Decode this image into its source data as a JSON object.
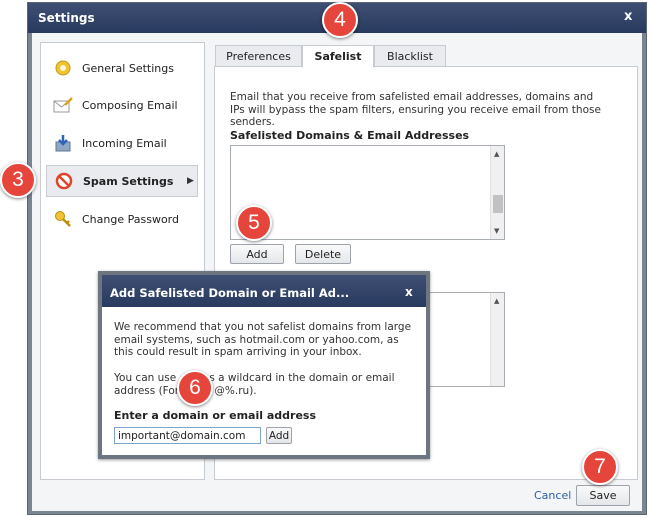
{
  "window": {
    "title": "Settings",
    "close_glyph": "x"
  },
  "sidebar": {
    "items": [
      {
        "label": "General Settings",
        "icon": "gear-icon"
      },
      {
        "label": "Composing Email",
        "icon": "compose-icon"
      },
      {
        "label": "Incoming Email",
        "icon": "inbox-arrow-icon"
      },
      {
        "label": "Spam Settings",
        "icon": "no-entry-icon",
        "selected": true
      },
      {
        "label": "Change Password",
        "icon": "key-icon"
      }
    ],
    "active_arrow": "▶"
  },
  "tabs": [
    {
      "label": "Preferences"
    },
    {
      "label": "Safelist",
      "active": true
    },
    {
      "label": "Blacklist"
    }
  ],
  "safelist": {
    "description": "Email that you receive from safelisted email addresses, domains and IPs will bypass the spam filters, ensuring you receive email from those senders.",
    "section_title": "Safelisted Domains & Email Addresses",
    "add_label": "Add",
    "delete_label": "Delete"
  },
  "modal": {
    "title": "Add Safelisted Domain or Email Ad...",
    "close_glyph": "x",
    "para1": "We recommend that you not safelist domains from large email systems, such as hotmail.com or yahoo.com, as this could result in spam arriving in your inbox.",
    "para2_a": "You can use ",
    "para2_b": " as a wildcard in the domain or email",
    "para2_c": "address (For",
    "para2_d": "e: @%.ru).",
    "field_label": "Enter a domain or email address",
    "field_value": "important@domain.com",
    "add_label": "Add"
  },
  "footer": {
    "cancel_label": "Cancel",
    "save_label": "Save"
  },
  "callouts": [
    "3",
    "4",
    "5",
    "6",
    "7"
  ],
  "colors": {
    "titlebar": "#283a5f",
    "callout": "#e5453b",
    "link": "#2b5fa8"
  }
}
